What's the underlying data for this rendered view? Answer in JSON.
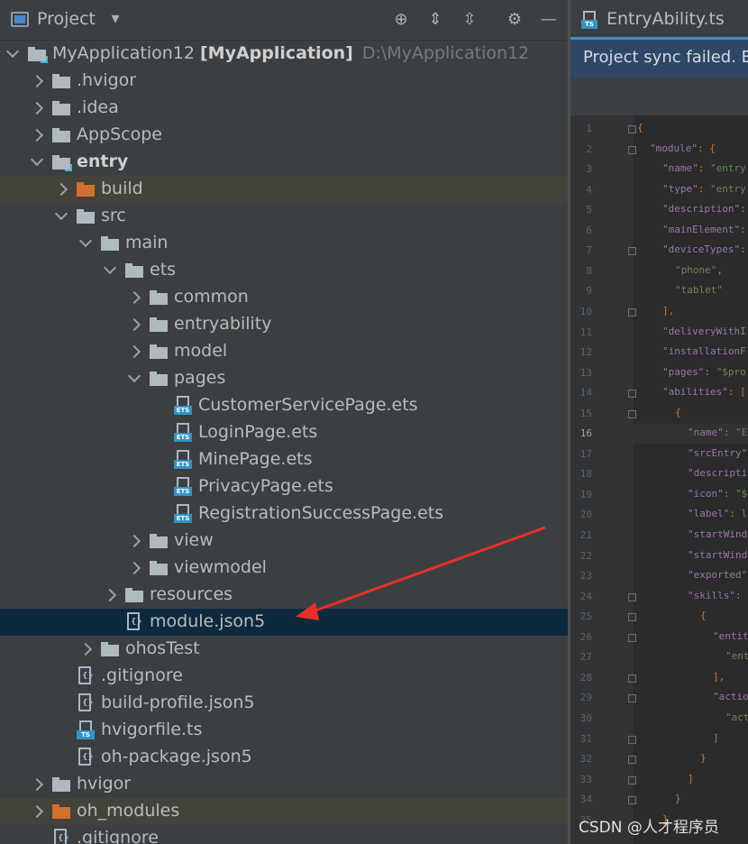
{
  "project_panel": {
    "title": "Project",
    "toolbar_icons": [
      "locate-icon",
      "expand-all-icon",
      "collapse-all-icon",
      "settings-icon",
      "hide-icon"
    ],
    "tree": [
      {
        "name": "MyApplication12",
        "module_name": "[MyApplication]",
        "path": "D:\\MyApplication12",
        "type": "module",
        "level": 0,
        "expanded": true
      },
      {
        "name": ".hvigor",
        "type": "folder",
        "level": 1,
        "expanded": false
      },
      {
        "name": ".idea",
        "type": "folder",
        "level": 1,
        "expanded": false
      },
      {
        "name": "AppScope",
        "type": "folder",
        "level": 1,
        "expanded": false
      },
      {
        "name": "entry",
        "type": "module",
        "level": 1,
        "expanded": true
      },
      {
        "name": "build",
        "type": "folder-excluded",
        "level": 2,
        "expanded": false
      },
      {
        "name": "src",
        "type": "folder",
        "level": 2,
        "expanded": true
      },
      {
        "name": "main",
        "type": "folder",
        "level": 3,
        "expanded": true
      },
      {
        "name": "ets",
        "type": "folder",
        "level": 4,
        "expanded": true
      },
      {
        "name": "common",
        "type": "folder",
        "level": 5,
        "expanded": false
      },
      {
        "name": "entryability",
        "type": "folder",
        "level": 5,
        "expanded": false
      },
      {
        "name": "model",
        "type": "folder",
        "level": 5,
        "expanded": false
      },
      {
        "name": "pages",
        "type": "folder",
        "level": 5,
        "expanded": true
      },
      {
        "name": "CustomerServicePage.ets",
        "type": "ets",
        "level": 6
      },
      {
        "name": "LoginPage.ets",
        "type": "ets",
        "level": 6
      },
      {
        "name": "MinePage.ets",
        "type": "ets",
        "level": 6
      },
      {
        "name": "PrivacyPage.ets",
        "type": "ets",
        "level": 6
      },
      {
        "name": "RegistrationSuccessPage.ets",
        "type": "ets",
        "level": 6
      },
      {
        "name": "view",
        "type": "folder",
        "level": 5,
        "expanded": false
      },
      {
        "name": "viewmodel",
        "type": "folder",
        "level": 5,
        "expanded": false
      },
      {
        "name": "resources",
        "type": "folder",
        "level": 4,
        "expanded": false
      },
      {
        "name": "module.json5",
        "type": "json",
        "level": 4,
        "selected": true
      },
      {
        "name": "ohosTest",
        "type": "folder",
        "level": 3,
        "expanded": false
      },
      {
        "name": ".gitignore",
        "type": "json",
        "level": 2
      },
      {
        "name": "build-profile.json5",
        "type": "json",
        "level": 2
      },
      {
        "name": "hvigorfile.ts",
        "type": "ts",
        "level": 2
      },
      {
        "name": "oh-package.json5",
        "type": "json",
        "level": 2
      },
      {
        "name": "hvigor",
        "type": "folder",
        "level": 1,
        "expanded": false
      },
      {
        "name": "oh_modules",
        "type": "folder-excluded",
        "level": 1,
        "expanded": false
      },
      {
        "name": ".gitignore",
        "type": "json",
        "level": 1
      }
    ]
  },
  "editor": {
    "tab_label": "EntryAbility.ts",
    "tab_icon_label": "TS",
    "ets_icon_label": "ETS",
    "sync_banner": "Project sync failed. Ba",
    "current_line": 16,
    "line_numbers": [
      "1",
      "2",
      "3",
      "4",
      "5",
      "6",
      "7",
      "8",
      "9",
      "10",
      "11",
      "12",
      "13",
      "14",
      "15",
      "16",
      "17",
      "18",
      "19",
      "20",
      "21",
      "22",
      "23",
      "24",
      "25",
      "26",
      "27",
      "28",
      "29",
      "30",
      "31",
      "32",
      "33",
      "34",
      "35"
    ],
    "code_lines": [
      [
        {
          "t": "{",
          "c": "p"
        }
      ],
      [
        {
          "t": "\"module\"",
          "c": "k"
        },
        {
          "t": ": {",
          "c": "p"
        }
      ],
      [
        {
          "t": "\"name\"",
          "c": "k"
        },
        {
          "t": ": ",
          "c": "p"
        },
        {
          "t": "\"entry",
          "c": "s"
        }
      ],
      [
        {
          "t": "\"type\"",
          "c": "k"
        },
        {
          "t": ": ",
          "c": "p"
        },
        {
          "t": "\"entry",
          "c": "s"
        }
      ],
      [
        {
          "t": "\"description\"",
          "c": "k"
        },
        {
          "t": ":",
          "c": "p"
        }
      ],
      [
        {
          "t": "\"mainElement\"",
          "c": "k"
        },
        {
          "t": ":",
          "c": "p"
        }
      ],
      [
        {
          "t": "\"deviceTypes\"",
          "c": "k"
        },
        {
          "t": ":",
          "c": "p"
        }
      ],
      [
        {
          "t": "\"phone\"",
          "c": "s"
        },
        {
          "t": ",",
          "c": "p"
        }
      ],
      [
        {
          "t": "\"tablet\"",
          "c": "s"
        }
      ],
      [
        {
          "t": "],",
          "c": "p"
        }
      ],
      [
        {
          "t": "\"deliveryWithI",
          "c": "k"
        }
      ],
      [
        {
          "t": "\"installationF",
          "c": "k"
        }
      ],
      [
        {
          "t": "\"pages\"",
          "c": "k"
        },
        {
          "t": ": ",
          "c": "p"
        },
        {
          "t": "\"$pro",
          "c": "s"
        }
      ],
      [
        {
          "t": "\"abilities\"",
          "c": "k"
        },
        {
          "t": ": [",
          "c": "p"
        }
      ],
      [
        {
          "t": "{",
          "c": "p"
        }
      ],
      [
        {
          "t": "\"name\"",
          "c": "k"
        },
        {
          "t": ": ",
          "c": "p"
        },
        {
          "t": "\"E",
          "c": "s"
        }
      ],
      [
        {
          "t": "\"srcEntry\"",
          "c": "k"
        }
      ],
      [
        {
          "t": "\"descripti",
          "c": "k"
        }
      ],
      [
        {
          "t": "\"icon\"",
          "c": "k"
        },
        {
          "t": ": ",
          "c": "p"
        },
        {
          "t": "\"$",
          "c": "s"
        }
      ],
      [
        {
          "t": "\"label\"",
          "c": "k"
        },
        {
          "t": ": ",
          "c": "p"
        },
        {
          "t": "l",
          "c": "s"
        }
      ],
      [
        {
          "t": "\"startWind",
          "c": "k"
        }
      ],
      [
        {
          "t": "\"startWind",
          "c": "k"
        }
      ],
      [
        {
          "t": "\"exported\"",
          "c": "k"
        }
      ],
      [
        {
          "t": "\"skills\"",
          "c": "k"
        },
        {
          "t": ": ",
          "c": "p"
        }
      ],
      [
        {
          "t": "{",
          "c": "p"
        }
      ],
      [
        {
          "t": "\"entit",
          "c": "k"
        }
      ],
      [
        {
          "t": "\"ent",
          "c": "s"
        }
      ],
      [
        {
          "t": "],",
          "c": "p"
        }
      ],
      [
        {
          "t": "\"actio",
          "c": "k"
        }
      ],
      [
        {
          "t": "\"act",
          "c": "s"
        }
      ],
      [
        {
          "t": "]",
          "c": "p"
        }
      ],
      [
        {
          "t": "}",
          "c": "p"
        }
      ],
      [
        {
          "t": "]",
          "c": "p"
        }
      ],
      [
        {
          "t": "}",
          "c": "p"
        }
      ],
      [
        {
          "t": "}",
          "c": "p"
        }
      ]
    ]
  },
  "watermark": "CSDN @人才程序员",
  "colors": {
    "panel_bg": "#3c3f41",
    "editor_bg": "#2b2b2b",
    "selection": "#0d293e",
    "banner": "#2e4766",
    "arrow": "#e8302a"
  }
}
